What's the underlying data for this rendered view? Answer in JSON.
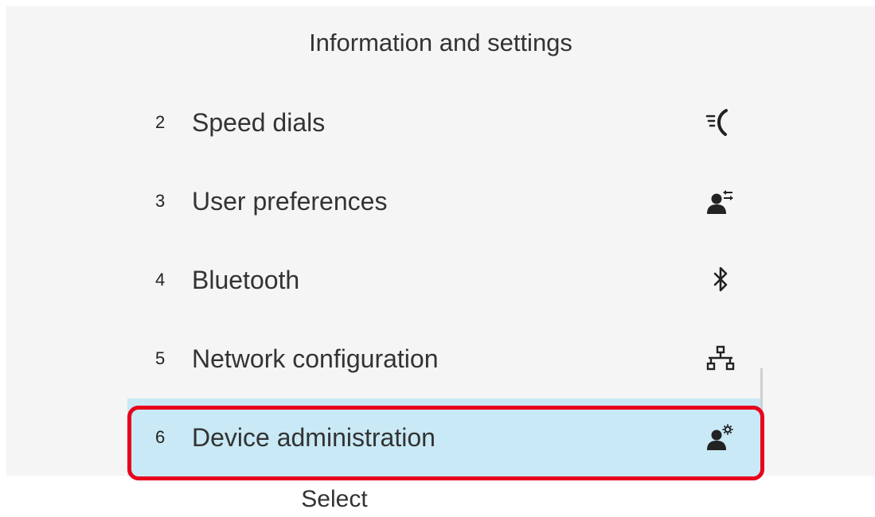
{
  "header": {
    "title": "Information and settings"
  },
  "menu": {
    "items": [
      {
        "number": "2",
        "label": "Speed dials",
        "icon": "speed-dial-icon"
      },
      {
        "number": "3",
        "label": "User preferences",
        "icon": "user-preferences-icon"
      },
      {
        "number": "4",
        "label": "Bluetooth",
        "icon": "bluetooth-icon"
      },
      {
        "number": "5",
        "label": "Network configuration",
        "icon": "network-icon"
      },
      {
        "number": "6",
        "label": "Device administration",
        "icon": "device-admin-icon",
        "selected": true
      }
    ]
  },
  "softkeys": {
    "select_label": "Select"
  },
  "colors": {
    "background": "#f5f5f5",
    "selected_row": "#c8e9f5",
    "highlight_border": "#e8001c"
  }
}
